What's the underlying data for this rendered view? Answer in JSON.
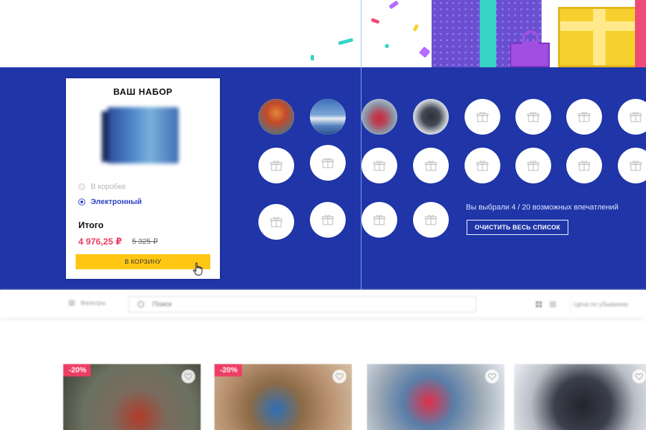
{
  "kit": {
    "title": "ВАШ НАБОР",
    "options": [
      {
        "label": "В коробке",
        "selected": false
      },
      {
        "label": "Электронный",
        "selected": true
      }
    ],
    "total_label": "Итого",
    "price_now": "4 976,25 ₽",
    "price_old": "5 325 ₽",
    "cart_button": "В КОРЗИНУ"
  },
  "selection": {
    "chosen_text": "Вы выбрали 4 / 20 возможных впечатлений",
    "clear_button": "ОЧИСТИТЬ ВЕСЬ СПИСОК",
    "selected_count": 4,
    "max_count": 20
  },
  "filters": {
    "filters_label": "Фильтры",
    "search_placeholder": "Поиск",
    "sort_label": "Цена по убыванию"
  },
  "products": [
    {
      "discount": "-20%"
    },
    {
      "discount": "-20%"
    },
    {
      "discount": ""
    },
    {
      "discount": ""
    }
  ],
  "colors": {
    "brand_blue": "#1f35a8",
    "accent_red": "#ee3d63",
    "cart_yellow": "#ffc714"
  }
}
